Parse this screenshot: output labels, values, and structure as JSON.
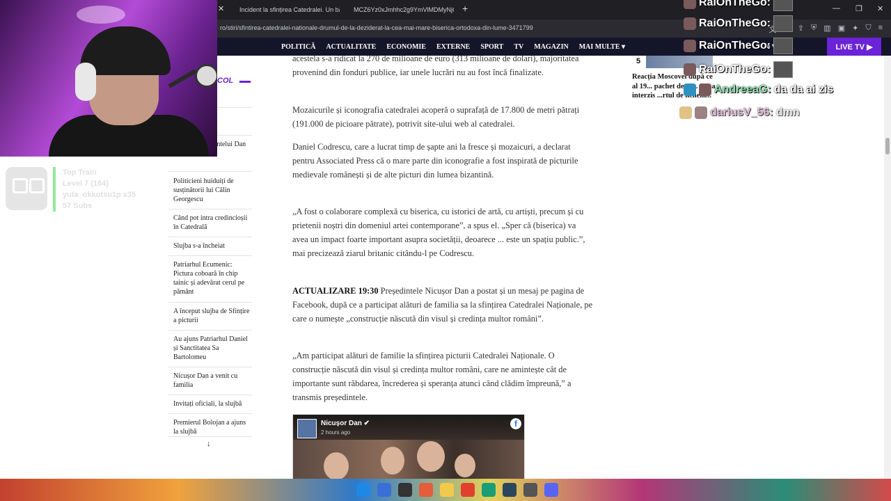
{
  "browser": {
    "tabs": [
      {
        "title": "Incident la sfințirea Catedralei. Un bă",
        "favicon_color": "#5b3fd6"
      },
      {
        "title": "MCZ6Yz0xJmhhc2g9YmVlMDMyNjQ",
        "favicon_color": "#3b78d8"
      }
    ],
    "url": "ro/stiri/sfintirea-catedralei-nationale-drumul-de-la-deziderat-la-cea-mai-mare-biserica-ortodoxa-din-lume-3471799"
  },
  "site_nav": {
    "items": [
      "POLITICĂ",
      "ACTUALITATE",
      "ECONOMIE",
      "EXTERNE",
      "SPORT",
      "TV",
      "MAGAZIN",
      "MAI MULTE ▾"
    ],
    "partial_right": "M ▾",
    "live_tv": "LIVE TV ▶",
    "accent_color": "#6a23d6"
  },
  "sidebar": {
    "heading": "COL",
    "items": [
      "...ntirea",
      "...ante cu ...ședintelui Dan",
      "Politicieni huiduiți de susținătorii lui Călin Georgescu",
      "Când pot intra credincioșii în Catedrală",
      "Slujba s-a încheiat",
      "Patriarhul Ecumenic: Pictura coboară în chip tainic și adevărat cerul pe pământ",
      "A început slujba de Sfințire a picturii",
      "Au ajuns Patriarhul Daniel și Sanctitatea Sa Bartolomeu",
      "Nicușor Dan a venit cu familia",
      "Invitați oficiali, la slujbă",
      "Premierul Bolojan a ajuns la slujbă"
    ],
    "more_arrow": "↓"
  },
  "article": {
    "p1": "acestela s-a ridicat la 270 de milioane de euro (313 milioane de dolari), majoritatea provenind din fonduri publice, iar unele lucrări nu au fost încă finalizate.",
    "p2": "Mozaicurile și iconografia catedralei acoperă o suprafață de 17.800 de metri pătrați (191.000 de picioare pătrate), potrivit site-ului web al catedralei.",
    "p3": "Daniel Codrescu, care a lucrat timp de șapte ani la frescе și mozaicuri, a declarat pentru Associated Press că o mare parte din iconografie a fost inspirată de picturile medievale românești și de alte picturi din lumea bizantină.",
    "p4": "„A fost o colaborare complexă cu biserica, cu istorici de artă, cu artiști, precum și cu prietenii noștri din domeniul artei contemporane”, a spus el. „Sper că (biserica) va avea un impact foarte important asupra societății, deoarece ... este un spațiu public.”, mai precizează ziarul britanic citându-l pe Codrescu.",
    "update_label": "ACTUALIZARE 19:30",
    "p5": " Președintele Nicușor Dan a postat și un mesaj pe pagina de Facebook, după ce a participat alături de familia sa la sfințirea Catedralei Naționale, pe care o numește „construcție născută din visul și credința multor români”.",
    "p6": "„Am participat alături de familie la sfințirea picturii Catedralei Naționale. O construcție născută din visul și credința multor români, care ne amintește cât de importante sunt răbdarea, încrederea și speranța atunci când clădim împreună,” a transmis președintele.",
    "fb_embed": {
      "name": "Nicușor Dan ✔",
      "time": "2 hours ago",
      "logo": "f"
    }
  },
  "right_column": {
    "rank": "5",
    "headline": "Reacția Moscovei după ce al 19... pachet de sa... UE a interzis ...rtul de licheni..."
  },
  "overlay": {
    "cam_badge": "",
    "train": {
      "title": "Top Train",
      "level": "Level 7  (164)",
      "user": "yuta_okkotsu1p x35",
      "subs": "57 Subs"
    },
    "chat": [
      {
        "user": "RaiOnTheGo:",
        "msg": "",
        "color": "#ffffff"
      },
      {
        "user": "RaiOnTheGo:",
        "msg": "",
        "color": "#ffffff"
      },
      {
        "user": "RaiOnTheGo:",
        "msg": "",
        "color": "#ffffff"
      },
      {
        "user": "RaiOnTheGo:",
        "msg": "",
        "color": "#ffffff"
      },
      {
        "user": "AndreeaG:",
        "msg": "da da ai zis",
        "color": "#8fe0b0"
      },
      {
        "user": "dariusV_56:",
        "msg": "dmn",
        "color": "#d6a3c8"
      }
    ]
  }
}
